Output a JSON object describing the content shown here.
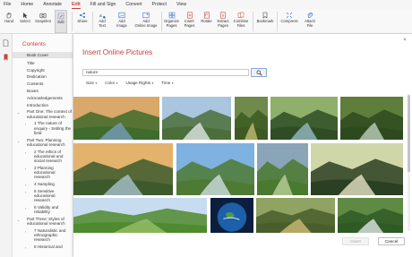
{
  "menu": {
    "items": [
      {
        "label": "File"
      },
      {
        "label": "Home"
      },
      {
        "label": "Annotate"
      },
      {
        "label": "Edit",
        "active": true
      },
      {
        "label": "Fill and Sign"
      },
      {
        "label": "Convert"
      },
      {
        "label": "Protect"
      },
      {
        "label": "View"
      }
    ]
  },
  "ribbon": {
    "hand": "Hand",
    "select": "Select",
    "snapshot": "Snapshot",
    "edit": "Edit",
    "share": "Share",
    "add_text_l1": "Add",
    "add_text_l2": "Text",
    "add_image_l1": "Add",
    "add_image_l2": "Image",
    "add_online_l1": "Add",
    "add_online_l2": "Online Image",
    "organize_l1": "Organize",
    "organize_l2": "Pages",
    "insert_l1": "Insert",
    "insert_l2": "Pages",
    "rotate": "Rotate",
    "extract_l1": "Extract",
    "extract_l2": "Pages",
    "combine_l1": "Combine",
    "combine_l2": "Files",
    "bookmark": "Bookmark",
    "compress": "Compress",
    "attach_l1": "Attach",
    "attach_l2": "File"
  },
  "contents": {
    "title": "Contents",
    "items": [
      {
        "label": "Book Cover",
        "selected": true
      },
      {
        "label": "Title"
      },
      {
        "label": "Copyright"
      },
      {
        "label": "Dedication"
      },
      {
        "label": "Contents"
      },
      {
        "label": "Boxes"
      },
      {
        "label": "Acknowledgements"
      },
      {
        "label": "Introduction"
      },
      {
        "label": "Part One: The context of educational research",
        "toggle": "⌄"
      },
      {
        "label": "1 The nature of enquiry - Setting the field",
        "sub": true,
        "toggle": "›"
      },
      {
        "label": "Part Two: Planning educational research",
        "toggle": "⌄"
      },
      {
        "label": "2 The ethics of educational and social research",
        "sub": true,
        "toggle": "›"
      },
      {
        "label": "3 Planning educational research",
        "sub": true,
        "toggle": "›"
      },
      {
        "label": "4 Sampling",
        "sub": true,
        "toggle": "›"
      },
      {
        "label": "5 Sensitive educational research",
        "sub": true,
        "toggle": "›"
      },
      {
        "label": "6 Validity and reliability",
        "sub": true,
        "toggle": "›"
      },
      {
        "label": "Part Three: Styles of educational research",
        "toggle": "⌄"
      },
      {
        "label": "7 Naturalistic and ethnographic research",
        "sub": true,
        "toggle": "›"
      },
      {
        "label": "8 Historical and",
        "sub": true,
        "toggle": "›"
      }
    ]
  },
  "dialog": {
    "title": "Insert Online Pictures",
    "search_value": "nature",
    "filters": [
      {
        "label": "Size"
      },
      {
        "label": "Color"
      },
      {
        "label": "Usage Rights"
      },
      {
        "label": "Time"
      }
    ],
    "insert_label": "Insert",
    "cancel_label": "Cancel"
  },
  "colors": {
    "accent": "#c8413b",
    "icon_blue": "#2e6fd0"
  },
  "images": [
    {
      "name": "lake-sunset",
      "sky": "#d9a86a",
      "ground": "#3f6b2c",
      "accent": "#7aa0c4"
    },
    {
      "name": "waterfall-rocks",
      "sky": "#a9c6de",
      "ground": "#4c6e3a",
      "accent": "#e9eef2"
    },
    {
      "name": "forest-path",
      "sky": "#6f8a4b",
      "ground": "#3c5a22",
      "accent": "#c9c27a"
    },
    {
      "name": "forest-river",
      "sky": "#8fb06b",
      "ground": "#2f4d24",
      "accent": "#9cc0d0"
    },
    {
      "name": "mossy-stream",
      "sky": "#5f7d3b",
      "ground": "#2d4a1e",
      "accent": "#c7d7c8"
    },
    {
      "name": "mountain-lake-sunrise",
      "sky": "#e3b26c",
      "ground": "#3d5a2c",
      "accent": "#b0c9d8"
    },
    {
      "name": "alpine-river-valley",
      "sky": "#7fb2e0",
      "ground": "#4e7a34",
      "accent": "#d7e6ee"
    },
    {
      "name": "green-valley",
      "sky": "#8aa4b8",
      "ground": "#4a7a2f",
      "accent": "#c3d6a4"
    },
    {
      "name": "people-in-forest",
      "sky": "#cfd7a8",
      "ground": "#2b3f22",
      "accent": "#f1efd0"
    },
    {
      "name": "green-hills",
      "sky": "#c7dcef",
      "ground": "#4f8a2e",
      "accent": "#9bc36a"
    },
    {
      "name": "earth-globe",
      "sky": "#0b1e3d",
      "ground": "#1d5fa8",
      "accent": "#e7f0fa"
    },
    {
      "name": "autumn-forest",
      "sky": "#8fa363",
      "ground": "#4a5e2c",
      "accent": "#d7c37a"
    },
    {
      "name": "tropical-waterfall",
      "sky": "#5f8a44",
      "ground": "#2f5a24",
      "accent": "#e9f0f2"
    }
  ]
}
